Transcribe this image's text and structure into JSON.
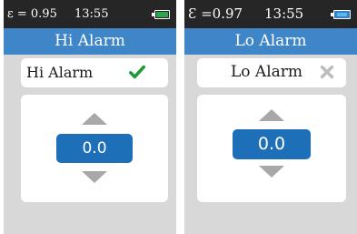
{
  "screens": [
    {
      "status": {
        "emissivity": "ε = 0.95",
        "time": "13:55",
        "battery_icon": "battery-full-icon"
      },
      "title": "Hi Alarm",
      "alarm": {
        "label": "Hi Alarm",
        "state_icon": "checkmark-icon",
        "enabled": true,
        "icon_color": "#1f9a3a"
      },
      "value": "0.0"
    },
    {
      "status": {
        "emissivity": "Ɛ =0.97",
        "time": "13:55",
        "battery_icon": "battery-full-icon"
      },
      "title": "Lo Alarm",
      "alarm": {
        "label": "Lo Alarm",
        "state_icon": "close-icon",
        "enabled": false,
        "icon_color": "#bdbdbd"
      },
      "value": "0.0"
    }
  ],
  "colors": {
    "title_bar": "#3f86c9",
    "value_box": "#1d6fb8",
    "status_bar": "#262626",
    "background": "#d8d8d8"
  }
}
